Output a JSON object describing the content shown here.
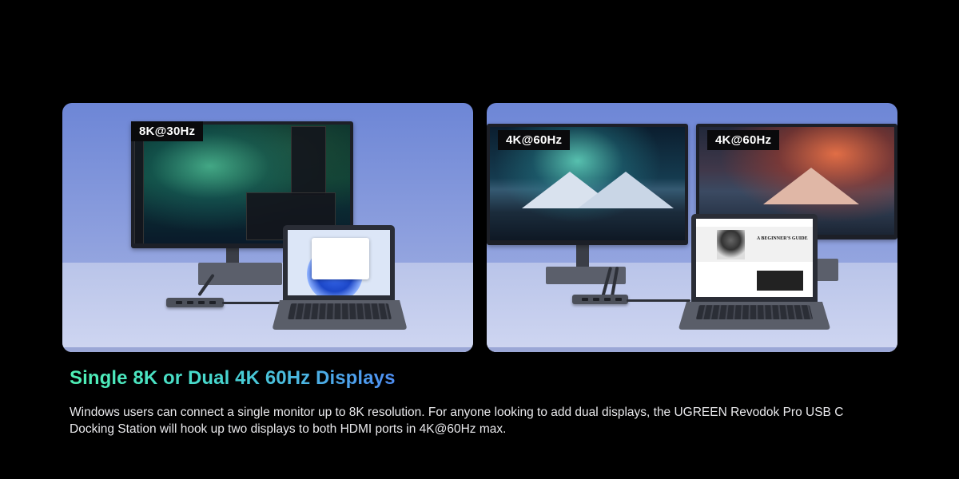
{
  "left_panel": {
    "resolution_label": "8K@30Hz"
  },
  "right_panel": {
    "resolution_label_left": "4K@60Hz",
    "resolution_label_right": "4K@60Hz"
  },
  "laptop_web_page": {
    "headline_line1": "A BEGINNER'S GUIDE"
  },
  "heading": "Single 8K or Dual 4K 60Hz Displays",
  "description": "Windows users can connect a single monitor up to 8K resolution. For anyone looking to add dual displays, the UGREEN Revodok Pro USB C Docking Station will hook up two displays to both HDMI ports in 4K@60Hz max.",
  "colors": {
    "heading_gradient_start": "#4ff0b4",
    "heading_gradient_end": "#4f8ff5",
    "background": "#000000",
    "panel_blue": "#7c93da"
  }
}
